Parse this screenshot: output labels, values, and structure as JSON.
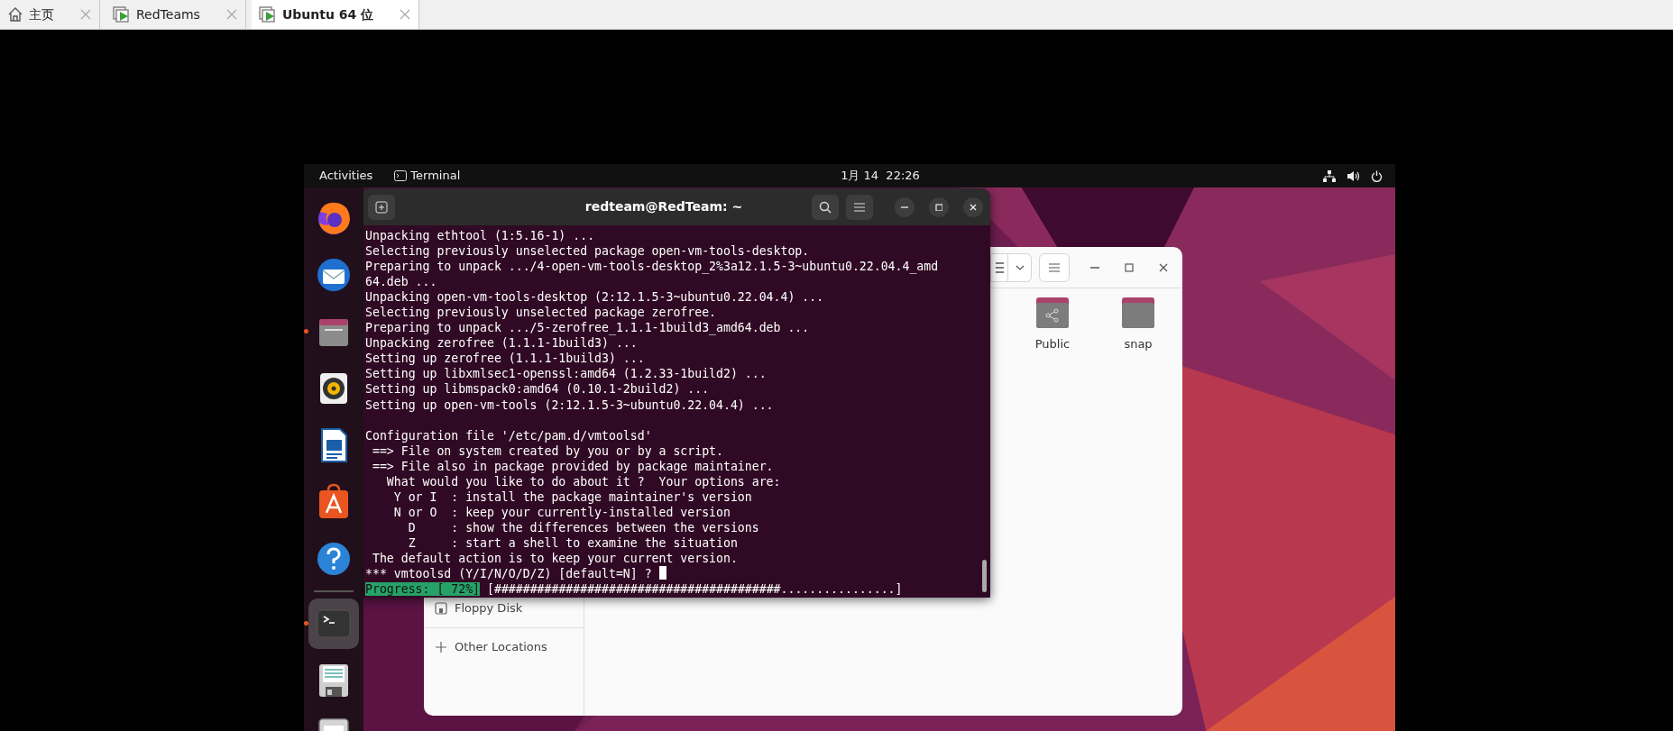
{
  "host_tabs": [
    {
      "label": "主页",
      "kind": "home",
      "selected": false
    },
    {
      "label": "RedTeams",
      "kind": "vm",
      "selected": false
    },
    {
      "label": "Ubuntu 64 位",
      "kind": "vm",
      "selected": true
    }
  ],
  "top_bar": {
    "activities": "Activities",
    "app": "Terminal",
    "clock": "1月 14  22:26"
  },
  "dock": [
    {
      "kind": "browser",
      "running": false,
      "selected": false
    },
    {
      "kind": "mail",
      "running": false,
      "selected": false
    },
    {
      "kind": "files",
      "running": true,
      "selected": false
    },
    {
      "kind": "music",
      "running": false,
      "selected": false
    },
    {
      "kind": "writer",
      "running": false,
      "selected": false
    },
    {
      "kind": "store",
      "running": false,
      "selected": false
    },
    {
      "kind": "help",
      "running": false,
      "selected": false
    },
    {
      "kind": "terminal",
      "running": true,
      "selected": true
    },
    {
      "kind": "floppy",
      "running": false,
      "selected": false
    },
    {
      "kind": "drive",
      "running": false,
      "selected": false
    }
  ],
  "files_window": {
    "sidebar": [
      {
        "label": "Floppy Disk",
        "kind": "drive"
      },
      {
        "label": "Other Locations",
        "kind": "add"
      }
    ],
    "folders": [
      {
        "name": "Public",
        "kind": "shared"
      },
      {
        "name": "snap",
        "kind": "plain"
      }
    ]
  },
  "terminal": {
    "title": "redteam@RedTeam: ~",
    "lines": [
      {
        "text": "Unpacking ethtool (1:5.16-1) ..."
      },
      {
        "text": "Selecting previously unselected package open-vm-tools-desktop."
      },
      {
        "text": "Preparing to unpack .../4-open-vm-tools-desktop_2%3a12.1.5-3~ubuntu0.22.04.4_amd"
      },
      {
        "text": "64.deb ..."
      },
      {
        "text": "Unpacking open-vm-tools-desktop (2:12.1.5-3~ubuntu0.22.04.4) ..."
      },
      {
        "text": "Selecting previously unselected package zerofree."
      },
      {
        "text": "Preparing to unpack .../5-zerofree_1.1.1-1build3_amd64.deb ..."
      },
      {
        "text": "Unpacking zerofree (1.1.1-1build3) ..."
      },
      {
        "text": "Setting up zerofree (1.1.1-1build3) ..."
      },
      {
        "text": "Setting up libxmlsec1-openssl:amd64 (1.2.33-1build2) ..."
      },
      {
        "text": "Setting up libmspack0:amd64 (0.10.1-2build2) ..."
      },
      {
        "text": "Setting up open-vm-tools (2:12.1.5-3~ubuntu0.22.04.4) ..."
      },
      {
        "text": "Configuration file '/etc/pam.d/vmtoolsd'",
        "gap_above": true
      },
      {
        "text": " ==> File on system created by you or by a script."
      },
      {
        "text": " ==> File also in package provided by package maintainer."
      },
      {
        "text": "   What would you like to do about it ?  Your options are:"
      },
      {
        "text": "    Y or I  : install the package maintainer's version"
      },
      {
        "text": "    N or O  : keep your currently-installed version"
      },
      {
        "text": "      D     : show the differences between the versions"
      },
      {
        "text": "      Z     : start a shell to examine the situation"
      },
      {
        "text": " The default action is to keep your current version."
      },
      {
        "text": "*** vmtoolsd (Y/I/N/O/D/Z) [default=N] ? ",
        "cursor": true
      }
    ],
    "progress": {
      "label": "Progress: [ 72%]",
      "bar": "[########################################................]"
    }
  }
}
